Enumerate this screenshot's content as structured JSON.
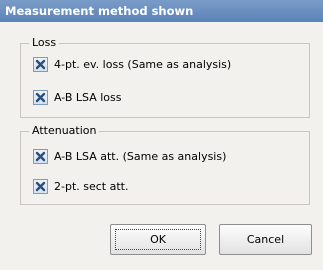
{
  "dialog": {
    "title": "Measurement method shown"
  },
  "groups": {
    "loss": {
      "legend": "Loss",
      "options": [
        {
          "label": "4-pt. ev. loss (Same as analysis)",
          "checked": true
        },
        {
          "label": "A-B LSA loss",
          "checked": true
        }
      ]
    },
    "attenuation": {
      "legend": "Attenuation",
      "options": [
        {
          "label": "A-B LSA att. (Same as analysis)",
          "checked": true
        },
        {
          "label": "2-pt. sect att.",
          "checked": true
        }
      ]
    }
  },
  "buttons": {
    "ok_label": "OK",
    "cancel_label": "Cancel"
  },
  "colors": {
    "titlebar": "#5b82b8",
    "checkmark": "#2a4f7d"
  }
}
